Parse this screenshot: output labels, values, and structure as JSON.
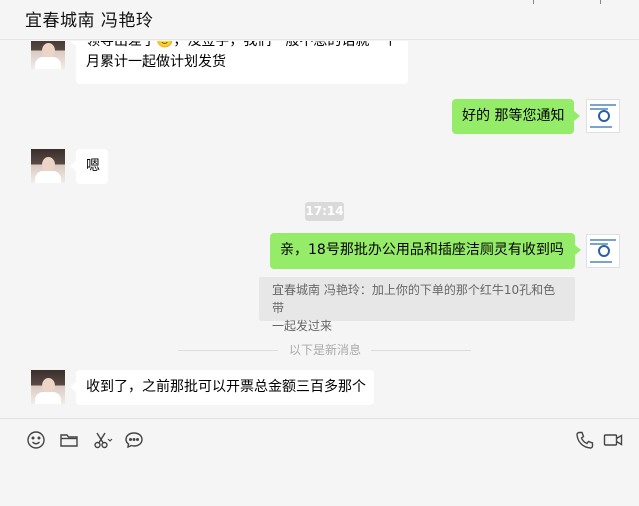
{
  "window": {
    "title": "宜春城南 冯艳玲"
  },
  "messages": {
    "m1": {
      "line1": "领导出差了🙂，没签字，我们一般不急的话就一个",
      "line2": "月累计一起做计划发货"
    },
    "m2": {
      "text": "好的 那等您通知"
    },
    "m3": {
      "text": "嗯"
    },
    "time": "17:14",
    "m4": {
      "text": "亲，18号那批办公用品和插座洁厕灵有收到吗"
    },
    "quote": {
      "line1": "宜春城南 冯艳玲：加上你的下单的那个红牛10孔和色带",
      "line2": "一起发过来"
    },
    "divider": "以下是新消息",
    "m5": {
      "text": "收到了，之前那批可以开票总金额三百多那个"
    }
  },
  "toolbar": {
    "left_icons": [
      "emoji-icon",
      "folder-icon",
      "scissors-icon",
      "chat-bubble-icon"
    ],
    "right_icons": [
      "phone-icon",
      "video-icon"
    ]
  },
  "colors": {
    "bubble_out": "#95ec69",
    "bubble_in": "#ffffff",
    "background": "#f5f5f5"
  }
}
